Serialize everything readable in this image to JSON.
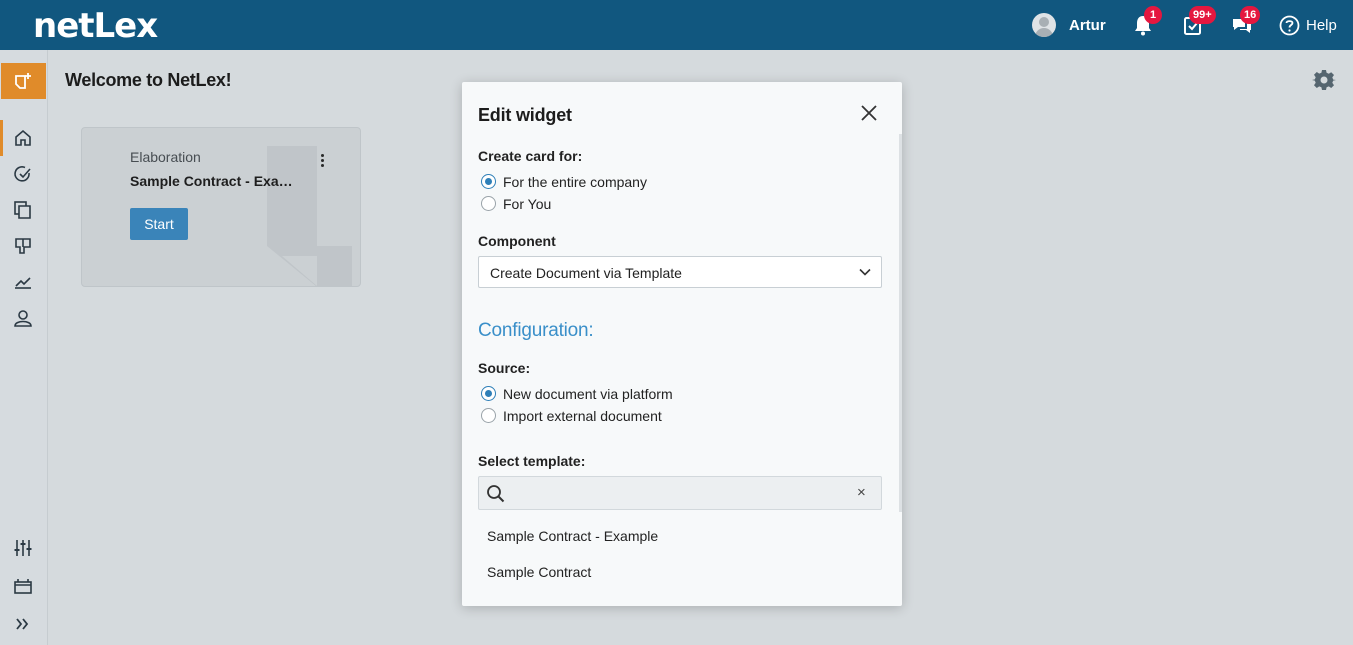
{
  "header": {
    "logo": "netLex",
    "user_name": "Artur",
    "notifications_count": "1",
    "tasks_count": "99+",
    "messages_count": "16",
    "help_label": "Help"
  },
  "page": {
    "title": "Welcome to NetLex!"
  },
  "card": {
    "category": "Elaboration",
    "title": "Sample Contract - Example",
    "start_label": "Start"
  },
  "modal": {
    "title": "Edit widget",
    "create_card_for_label": "Create card for:",
    "create_card_options": [
      "For the entire company",
      "For You"
    ],
    "create_card_selected": "For the entire company",
    "component_label": "Component",
    "component_value": "Create Document via Template",
    "configuration_title": "Configuration:",
    "source_label": "Source:",
    "source_options": [
      "New document via platform",
      "Import external document"
    ],
    "source_selected": "New document via platform",
    "select_template_label": "Select template:",
    "search_value": "",
    "template_options": [
      "Sample Contract - Example",
      "Sample Contract"
    ]
  },
  "colors": {
    "header_bg": "#11577f",
    "accent_orange": "#e08b2a",
    "primary_blue": "#3a84b9",
    "badge_red": "#e5173f"
  }
}
